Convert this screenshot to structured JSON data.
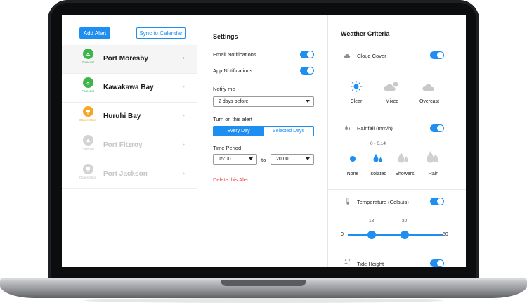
{
  "left": {
    "add_alert": "Add Alert",
    "sync": "Sync to Calendar",
    "locations": [
      {
        "name": "Port Moresby",
        "type": "Forecast",
        "arrow": "▸"
      },
      {
        "name": "Kawakawa Bay",
        "type": "Forecast",
        "arrow": "▸"
      },
      {
        "name": "Huruhi Bay",
        "type": "Observation",
        "arrow": "▸"
      },
      {
        "name": "Port Fitzroy",
        "type": "Forecast",
        "arrow": "▸"
      },
      {
        "name": "Port Jackson",
        "type": "Observation",
        "arrow": "▸"
      }
    ]
  },
  "settings": {
    "title": "Settings",
    "email": "Email Notifications",
    "app": "App Notifications",
    "notify_me": "Notify me",
    "notify_value": "2 days before",
    "turn_on": "Turn on this alert",
    "every_day": "Every Day",
    "selected_days": "Selected Days",
    "time_period": "Time Period",
    "from": "15:00",
    "to_label": "to",
    "to": "20:00",
    "delete": "Delete this Alert"
  },
  "criteria": {
    "title": "Weather Criteria",
    "cloud": {
      "label": "Cloud Cover",
      "options": [
        "Clear",
        "Mixed",
        "Overcast"
      ]
    },
    "rain": {
      "label": "Rainfall (mm/h)",
      "range": "0 - 0.14",
      "options": [
        "None",
        "Isolated",
        "Showers",
        "Rain"
      ]
    },
    "temp": {
      "label": "Temperature (Celsuis)",
      "min": "0",
      "max": "50",
      "low": "18",
      "high": "30"
    },
    "tide": {
      "label": "Tide Height"
    }
  },
  "colors": {
    "accent": "#1f8ef1",
    "forecast": "#3cb54a",
    "observation": "#f5a623",
    "danger": "#e8453c"
  }
}
